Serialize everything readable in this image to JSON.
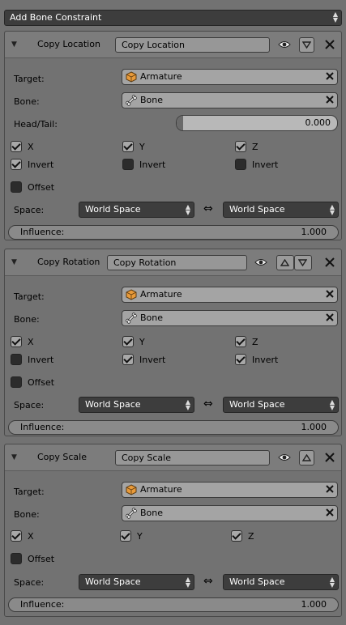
{
  "add_constraint": {
    "label": "Add Bone Constraint"
  },
  "constraints": [
    {
      "title": "Copy Location",
      "name_value": "Copy Location",
      "target_label": "Target:",
      "target_value": "Armature",
      "bone_label": "Bone:",
      "bone_value": "Bone",
      "headtail_label": "Head/Tail:",
      "headtail_value": "0.000",
      "x_label": "X",
      "y_label": "Y",
      "z_label": "Z",
      "x": true,
      "y": true,
      "z": true,
      "invert_label": "Invert",
      "invert_x": true,
      "invert_y": false,
      "invert_z": false,
      "offset_label": "Offset",
      "offset": false,
      "space_label": "Space:",
      "owner_space": "World Space",
      "target_space": "World Space",
      "influence_label": "Influence:",
      "influence_value": "1.000"
    },
    {
      "title": "Copy Rotation",
      "name_value": "Copy Rotation",
      "target_label": "Target:",
      "target_value": "Armature",
      "bone_label": "Bone:",
      "bone_value": "Bone",
      "x_label": "X",
      "y_label": "Y",
      "z_label": "Z",
      "x": true,
      "y": true,
      "z": true,
      "invert_label": "Invert",
      "invert_x": false,
      "invert_y": true,
      "invert_z": true,
      "offset_label": "Offset",
      "offset": false,
      "space_label": "Space:",
      "owner_space": "World Space",
      "target_space": "World Space",
      "influence_label": "Influence:",
      "influence_value": "1.000"
    },
    {
      "title": "Copy Scale",
      "name_value": "Copy Scale",
      "target_label": "Target:",
      "target_value": "Armature",
      "bone_label": "Bone:",
      "bone_value": "Bone",
      "x_label": "X",
      "y_label": "Y",
      "z_label": "Z",
      "x": true,
      "y": true,
      "z": true,
      "offset_label": "Offset",
      "offset": false,
      "space_label": "Space:",
      "owner_space": "World Space",
      "target_space": "World Space",
      "influence_label": "Influence:",
      "influence_value": "1.000"
    }
  ],
  "icons": {
    "eye": "eye-icon",
    "close": "close-icon",
    "armature": "armature-icon",
    "bone": "bone-icon",
    "swap": "swap-arrows-icon",
    "collapse": "disclosure-triangle-icon"
  },
  "colors": {
    "panel": "#727272",
    "dropdown": "#3d3d3d",
    "field": "#a4a4a4"
  }
}
